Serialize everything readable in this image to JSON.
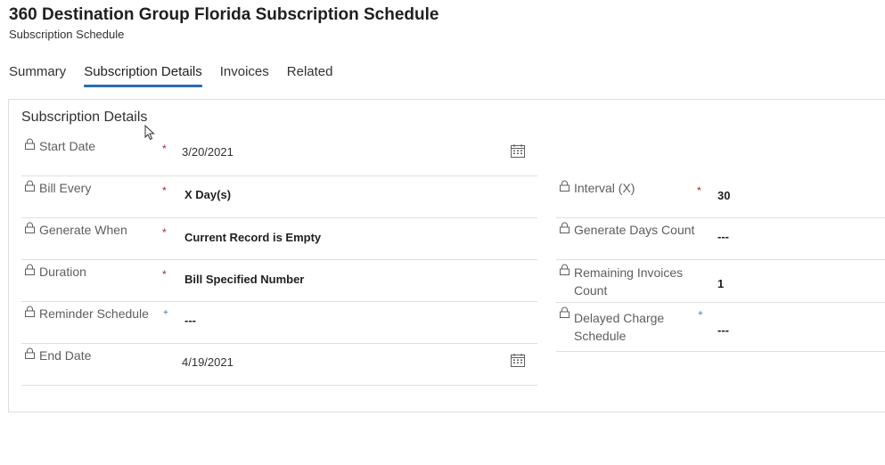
{
  "header": {
    "title": "360 Destination Group Florida Subscription Schedule",
    "subtitle": "Subscription Schedule"
  },
  "tabs": [
    {
      "label": "Summary",
      "active": false
    },
    {
      "label": "Subscription Details",
      "active": true
    },
    {
      "label": "Invoices",
      "active": false
    },
    {
      "label": "Related",
      "active": false
    }
  ],
  "section": {
    "title": "Subscription Details"
  },
  "left_fields": {
    "start_date": {
      "label": "Start Date",
      "required": "*",
      "value": "3/20/2021"
    },
    "bill_every": {
      "label": "Bill Every",
      "required": "*",
      "value": "X Day(s)"
    },
    "generate_when": {
      "label": "Generate When",
      "required": "*",
      "value": "Current Record is Empty"
    },
    "duration": {
      "label": "Duration",
      "required": "*",
      "value": "Bill Specified Number"
    },
    "reminder_schedule": {
      "label": "Reminder Schedule",
      "recommended": "+",
      "value": "---"
    },
    "end_date": {
      "label": "End Date",
      "value": "4/19/2021"
    }
  },
  "right_fields": {
    "interval": {
      "label": "Interval (X)",
      "required": "*",
      "value": "30"
    },
    "generate_days_count": {
      "label": "Generate Days Count",
      "value": "---"
    },
    "remaining_invoices_count": {
      "label": "Remaining Invoices Count",
      "value": "1"
    },
    "delayed_charge_schedule": {
      "label": "Delayed Charge Schedule",
      "recommended": "+",
      "value": "---"
    }
  },
  "colors": {
    "accent": "#2b6cb0",
    "required": "#a4262c",
    "border": "#e1dfdd"
  },
  "icons": [
    "lock-icon",
    "calendar-icon",
    "mouse-cursor-icon"
  ]
}
